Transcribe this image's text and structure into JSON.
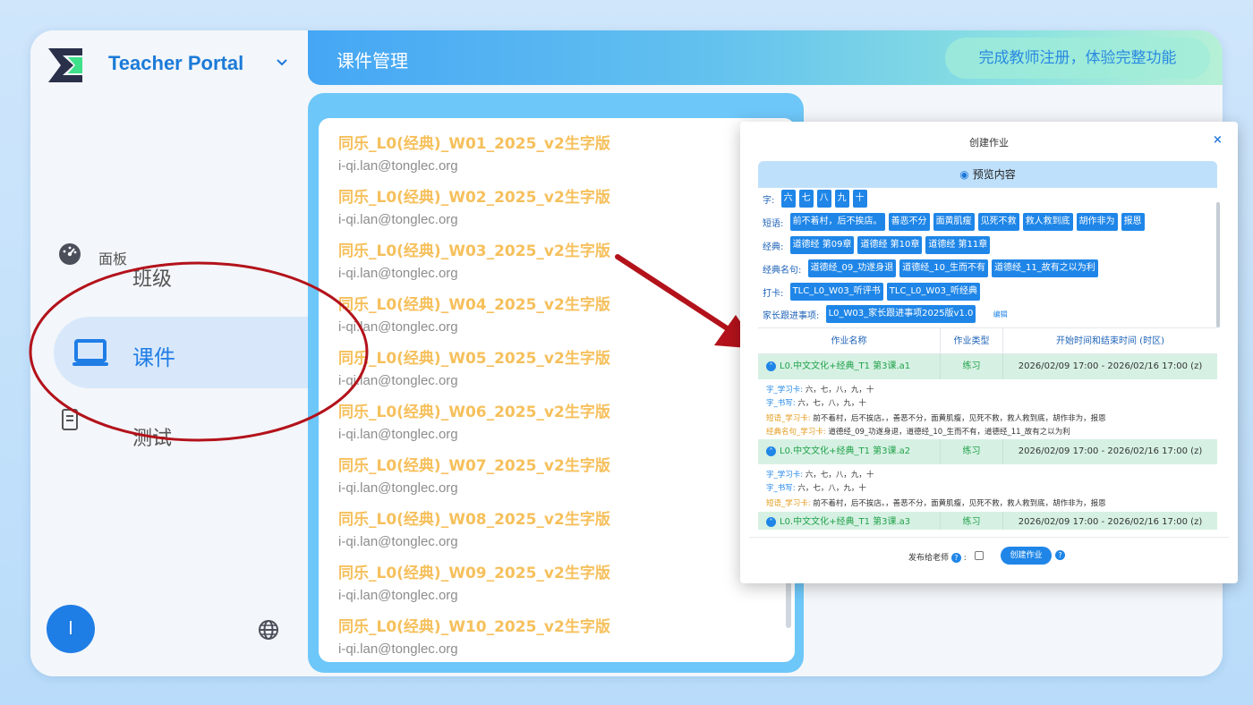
{
  "app": {
    "brand": "Teacher Portal",
    "avatar_letter": "l"
  },
  "sidebar": {
    "items": [
      {
        "label": "面板",
        "icon": "dashboard-icon"
      },
      {
        "label": "班级",
        "icon": "class-icon"
      },
      {
        "label": "课件",
        "icon": "laptop-icon",
        "active": true
      },
      {
        "label": "测试",
        "icon": "document-icon"
      }
    ]
  },
  "header": {
    "title": "课件管理",
    "cta": "完成教师注册，体验完整功能"
  },
  "courseware": [
    {
      "title": "同乐_L0(经典)_W01_2025_v2生字版",
      "email": "i-qi.lan@tonglec.org"
    },
    {
      "title": "同乐_L0(经典)_W02_2025_v2生字版",
      "email": "i-qi.lan@tonglec.org"
    },
    {
      "title": "同乐_L0(经典)_W03_2025_v2生字版",
      "email": "i-qi.lan@tonglec.org"
    },
    {
      "title": "同乐_L0(经典)_W04_2025_v2生字版",
      "email": "i-qi.lan@tonglec.org"
    },
    {
      "title": "同乐_L0(经典)_W05_2025_v2生字版",
      "email": "i-qi.lan@tonglec.org"
    },
    {
      "title": "同乐_L0(经典)_W06_2025_v2生字版",
      "email": "i-qi.lan@tonglec.org"
    },
    {
      "title": "同乐_L0(经典)_W07_2025_v2生字版",
      "email": "i-qi.lan@tonglec.org"
    },
    {
      "title": "同乐_L0(经典)_W08_2025_v2生字版",
      "email": "i-qi.lan@tonglec.org"
    },
    {
      "title": "同乐_L0(经典)_W09_2025_v2生字版",
      "email": "i-qi.lan@tonglec.org"
    },
    {
      "title": "同乐_L0(经典)_W10_2025_v2生字版",
      "email": "i-qi.lan@tonglec.org"
    }
  ],
  "modal": {
    "title": "创建作业",
    "close": "×",
    "preview_label": "预览内容",
    "preview": {
      "chars_label": "字:",
      "chars": [
        "六",
        "七",
        "八",
        "九",
        "十"
      ],
      "phrases_label": "短语:",
      "phrases": [
        "前不着村，后不挨店。",
        "善恶不分",
        "面黄肌瘦",
        "见死不救",
        "救人救到底",
        "胡作非为",
        "报恩"
      ],
      "classics_label": "经典:",
      "classics": [
        "道德经 第09章",
        "道德经 第10章",
        "道德经 第11章"
      ],
      "quotes_label": "经典名句:",
      "quotes": [
        "道德经_09_功遂身退",
        "道德经_10_生而不有",
        "道德经_11_故有之以为利"
      ],
      "checkin_label": "打卡:",
      "checkin": [
        "TLC_L0_W03_听评书",
        "TLC_L0_W03_听经典"
      ],
      "parent_label": "家长跟进事项:",
      "parent": [
        "L0_W03_家长跟进事项2025版v1.0"
      ],
      "edit": "编辑"
    },
    "table": {
      "headers": [
        "作业名称",
        "作业类型",
        "开始时间和结束时间 (时区)"
      ],
      "rows": [
        {
          "name": "L0.中文文化+经典_T1 第3课.a1",
          "type": "练习",
          "time": "2026/02/09 17:00 - 2026/02/16 17:00 (z)",
          "details": [
            {
              "key": "字_学习卡:",
              "value": " 六，七，八，九，十",
              "color": "blue"
            },
            {
              "key": "字_书写:",
              "value": " 六，七，八，九，十",
              "color": "blue"
            },
            {
              "key": "短语_学习卡:",
              "value": " 前不着村，后不挨店。，善恶不分，面黄肌瘦，见死不救，救人救到底，胡作非为，报恩",
              "color": "orange"
            },
            {
              "key": "经典名句_学习卡:",
              "value": " 道德经_09_功遂身退，道德经_10_生而不有，道德经_11_故有之以为利",
              "color": "orange"
            }
          ]
        },
        {
          "name": "L0.中文文化+经典_T1 第3课.a2",
          "type": "练习",
          "time": "2026/02/09 17:00 - 2026/02/16 17:00 (z)",
          "details": [
            {
              "key": "字_学习卡:",
              "value": " 六，七，八，九，十",
              "color": "blue"
            },
            {
              "key": "字_书写:",
              "value": " 六，七，八，九，十",
              "color": "blue"
            },
            {
              "key": "短语_学习卡:",
              "value": " 前不着村，后不挨店。，善恶不分，面黄肌瘦，见死不救，救人救到底，胡作非为，报恩",
              "color": "orange"
            }
          ]
        },
        {
          "name": "L0.中文文化+经典_T1 第3课.a3",
          "type": "练习",
          "time": "2026/02/09 17:00 - 2026/02/16 17:00 (z)",
          "details": []
        }
      ]
    },
    "footer": {
      "publish_label": "发布给老师",
      "help": "?",
      "create_button": "创建作业"
    }
  },
  "colors": {
    "accent": "#1f86e8",
    "courseware_title": "#f6c05c",
    "annotation": "#b3121b"
  }
}
